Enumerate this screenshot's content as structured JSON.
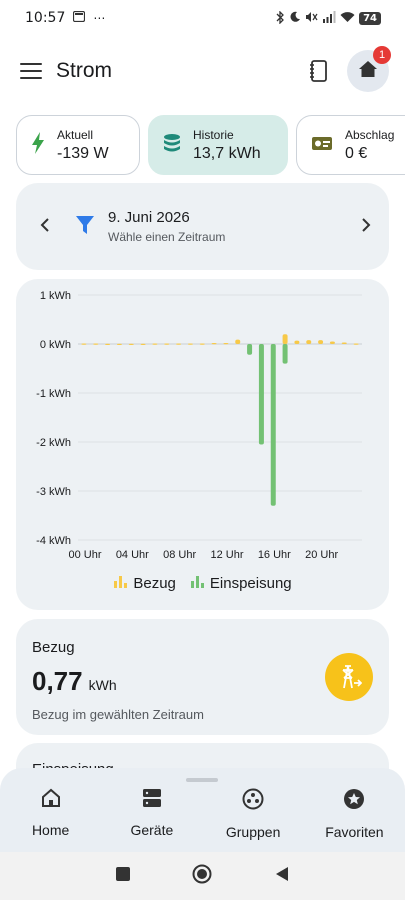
{
  "status": {
    "time": "10:57",
    "battery": "74"
  },
  "app": {
    "title": "Strom",
    "notification_count": "1"
  },
  "chips": [
    {
      "label": "Aktuell",
      "value": "-139 W"
    },
    {
      "label": "Historie",
      "value": "13,7 kWh"
    },
    {
      "label": "Abschlag",
      "value": "0 €"
    }
  ],
  "date_picker": {
    "date": "9. Juni 2026",
    "hint": "Wähle einen Zeitraum"
  },
  "chart_data": {
    "type": "bar",
    "categories": [
      "00",
      "01",
      "02",
      "03",
      "04",
      "05",
      "06",
      "07",
      "08",
      "09",
      "10",
      "11",
      "12",
      "13",
      "14",
      "15",
      "16",
      "17",
      "18",
      "19",
      "20",
      "21",
      "22",
      "23"
    ],
    "series": [
      {
        "name": "Bezug",
        "values": [
          0.01,
          0.01,
          0.005,
          0.005,
          0.005,
          0.005,
          0.01,
          0.01,
          0.01,
          0.01,
          0.01,
          0.02,
          0.02,
          0.09,
          0.0,
          0.0,
          0.0,
          0.2,
          0.07,
          0.08,
          0.08,
          0.05,
          0.03,
          0.01
        ]
      },
      {
        "name": "Einspeisung",
        "values": [
          0,
          0,
          0,
          0,
          0,
          0,
          0,
          0,
          0,
          0,
          0,
          0,
          0,
          0,
          -0.22,
          -2.05,
          -3.3,
          -0.4,
          0,
          0,
          0,
          0,
          0,
          0
        ]
      }
    ],
    "yticks": [
      "1 kWh",
      "0 kWh",
      "-1 kWh",
      "-2 kWh",
      "-3 kWh",
      "-4 kWh"
    ],
    "xticks": [
      "00 Uhr",
      "04 Uhr",
      "08 Uhr",
      "12 Uhr",
      "16 Uhr",
      "20 Uhr"
    ],
    "ylim": [
      -4,
      1
    ],
    "colors": {
      "Bezug": "#f7c948",
      "Einspeisung": "#73c173"
    },
    "legend_position": "bottom"
  },
  "stats": {
    "bezug": {
      "title": "Bezug",
      "value": "0,77",
      "unit": "kWh",
      "desc": "Bezug im gewählten Zeitraum"
    },
    "einspeisung": {
      "title": "Einspeisung"
    }
  },
  "bottom_nav": [
    {
      "label": "Home"
    },
    {
      "label": "Geräte"
    },
    {
      "label": "Gruppen"
    },
    {
      "label": "Favoriten"
    }
  ]
}
